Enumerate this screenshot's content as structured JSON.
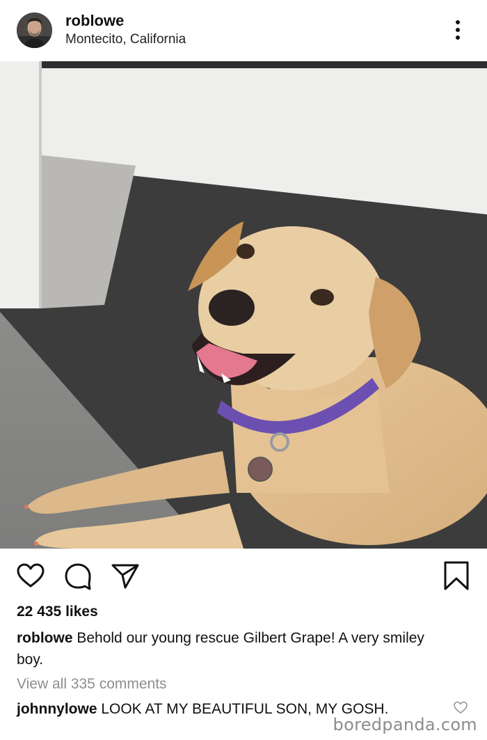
{
  "header": {
    "username": "roblowe",
    "location": "Montecito, California",
    "more_icon": "more-vertical-icon"
  },
  "post": {
    "image_subject": "smiling tan dog with purple collar lying on deck",
    "likes": "22 435 likes",
    "caption_user": "roblowe",
    "caption_text": " Behold our young rescue Gilbert Grape! A very smiley boy.",
    "view_all_comments": "View all 335 comments",
    "comment_user": "johnnylowe",
    "comment_text": " LOOK AT MY BEAUTIFUL SON, MY GOSH."
  },
  "actions": {
    "icons": [
      "heart-icon",
      "comment-icon",
      "share-icon",
      "bookmark-icon"
    ]
  },
  "watermark": "boredpanda.com"
}
